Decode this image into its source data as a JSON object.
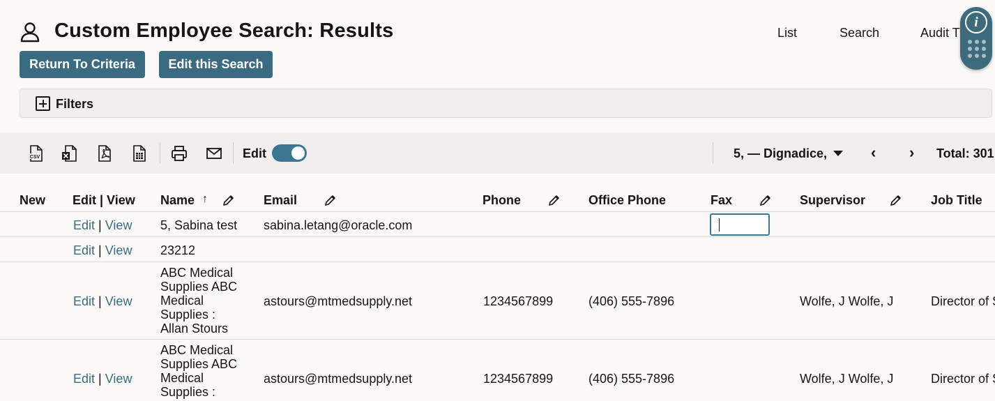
{
  "header": {
    "title": "Custom Employee Search: Results",
    "nav": [
      "List",
      "Search",
      "Audit T"
    ]
  },
  "actions": {
    "return_label": "Return To Criteria",
    "edit_label": "Edit this Search"
  },
  "filters": {
    "label": "Filters"
  },
  "toolbar": {
    "edit_label": "Edit",
    "edit_toggle_on": true,
    "record_selector": "5, — Dignadice,",
    "total": "Total: 301",
    "icons": [
      "csv-icon",
      "excel-icon",
      "pdf-icon",
      "spreadsheet-icon",
      "print-icon",
      "email-icon"
    ]
  },
  "table": {
    "columns": [
      "New",
      "Edit | View",
      "Name",
      "Email",
      "Phone",
      "Office Phone",
      "Fax",
      "Supervisor",
      "Job Title"
    ],
    "sorted_column": "Name",
    "link_edit": "Edit",
    "link_sep": "|",
    "link_view": "View",
    "rows": [
      {
        "name": "5, Sabina test",
        "email": "sabina.letang@oracle.com",
        "phone": "",
        "office_phone": "",
        "fax": "",
        "supervisor": "",
        "job_title": ""
      },
      {
        "name": "23212",
        "email": "",
        "phone": "",
        "office_phone": "",
        "fax": "",
        "supervisor": "",
        "job_title": ""
      },
      {
        "name": "ABC Medical Supplies ABC Medical Supplies : Allan Stours",
        "email": "astours@mtmedsupply.net",
        "phone": "1234567899",
        "office_phone": "(406) 555-7896",
        "fax": "",
        "supervisor": "Wolfe, J Wolfe, J",
        "job_title": "Director of S"
      },
      {
        "name": "ABC Medical Supplies ABC Medical Supplies :",
        "email": "astours@mtmedsupply.net",
        "phone": "1234567899",
        "office_phone": "(406) 555-7896",
        "fax": "",
        "supervisor": "Wolfe, J Wolfe, J",
        "job_title": "Director of S"
      }
    ]
  },
  "colors": {
    "primary_button": "#3a6b80",
    "link": "#3a6b80",
    "toggle": "#3a7892"
  }
}
